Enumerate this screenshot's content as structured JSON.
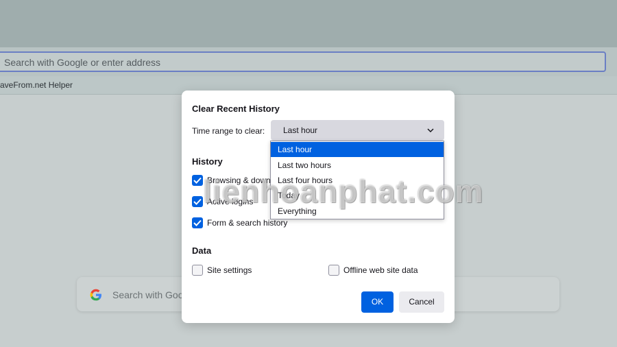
{
  "browser": {
    "address_placeholder": "Search with Google or enter address",
    "bookmark_item": "aveFrom.net Helper",
    "newtab_search_placeholder": "Search with Goo"
  },
  "dialog": {
    "title": "Clear Recent History",
    "time_range_label": "Time range to clear:",
    "time_range_selected": "Last hour",
    "time_range_options": [
      "Last hour",
      "Last two hours",
      "Last four hours",
      "Today",
      "Everything"
    ],
    "history_section": {
      "title": "History",
      "items": [
        {
          "label": "Browsing & down",
          "checked": true
        },
        {
          "label": "Active logins",
          "checked": true
        },
        {
          "label": "Form & search history",
          "checked": true
        }
      ]
    },
    "data_section": {
      "title": "Data",
      "items": [
        {
          "label": "Site settings",
          "checked": false
        },
        {
          "label": "Offline web site data",
          "checked": false
        }
      ]
    },
    "ok_label": "OK",
    "cancel_label": "Cancel"
  },
  "watermark": "lienhoanphat.com",
  "colors": {
    "accent": "#0061e0",
    "dialog_bg": "#ffffff",
    "select_bg": "#d8d8df"
  }
}
